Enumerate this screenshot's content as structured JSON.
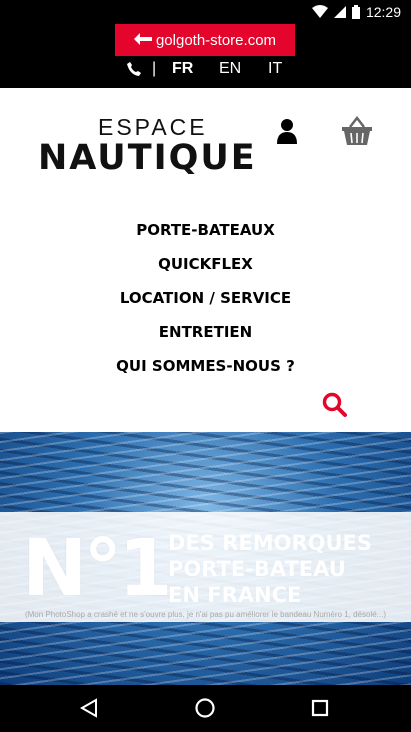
{
  "status_bar": {
    "time": "12:29",
    "icons": [
      "wifi-icon",
      "signal-icon",
      "battery-icon"
    ]
  },
  "top_bar": {
    "store_link": {
      "arrow": "🡐",
      "label": "golgoth-store.com"
    },
    "phone_icon": "phone-icon",
    "separator": "|",
    "languages": [
      {
        "code": "FR",
        "active": true
      },
      {
        "code": "EN",
        "active": false
      },
      {
        "code": "IT",
        "active": false
      }
    ]
  },
  "header": {
    "logo": {
      "line1": "ESPACE",
      "line2": "NAUTIQUE"
    },
    "icons": [
      "user-icon",
      "cart-icon"
    ]
  },
  "menu": [
    "PORTE-BATEAUX",
    "QUICKFLEX",
    "LOCATION / SERVICE",
    "ENTRETIEN",
    "QUI SOMMES-NOUS ?"
  ],
  "search": {
    "icon": "search-icon"
  },
  "hero": {
    "number": "N°1",
    "headline": "DES REMORQUES\nPORTE-BATEAU\nEN FRANCE",
    "note": "(Mon PhotoShop a crashé et ne s'ouvre plus, je n'ai pas pu améliorer le bandeau Numéro 1, désolé...)"
  },
  "android_nav": {
    "icons": [
      "back-icon",
      "home-icon",
      "recents-icon"
    ]
  },
  "colors": {
    "accent": "#e3052b",
    "black": "#000000",
    "text": "#111111"
  }
}
